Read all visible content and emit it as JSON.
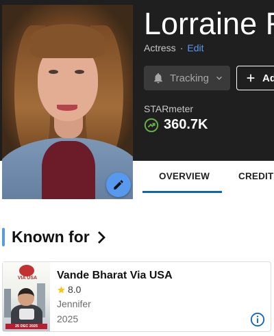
{
  "person": {
    "name": "Lorraine Ro",
    "role": "Actress",
    "edit_label": "Edit"
  },
  "actions": {
    "tracking_label": "Tracking",
    "add_label": "Ad"
  },
  "starmeter": {
    "title": "STARmeter",
    "value": "360.7K"
  },
  "tabs": [
    {
      "label": "OVERVIEW",
      "active": true
    },
    {
      "label": "CREDITS",
      "active": false
    }
  ],
  "known_for": {
    "title": "Known for",
    "items": [
      {
        "title": "Vande Bharat Via USA",
        "rating": "8.0",
        "character": "Jennifer",
        "year": "2025",
        "poster": {
          "logo_text": "VIA USA",
          "date_text": "25 DEC 2025"
        }
      }
    ]
  },
  "colors": {
    "accent_blue": "#5799ef",
    "tab_underline": "#0e63be",
    "star_yellow": "#f5c518",
    "starmeter_green": "#67ad4b",
    "hero_bg": "#1f1f1f"
  },
  "icons": {
    "edit_photo": "pencil-icon",
    "tracking": "bell-icon",
    "tracking_caret": "chevron-down-icon",
    "add": "plus-icon",
    "starmeter": "trend-up-icon",
    "section_arrow": "chevron-right-icon",
    "rating": "star-icon",
    "info": "info-icon"
  }
}
